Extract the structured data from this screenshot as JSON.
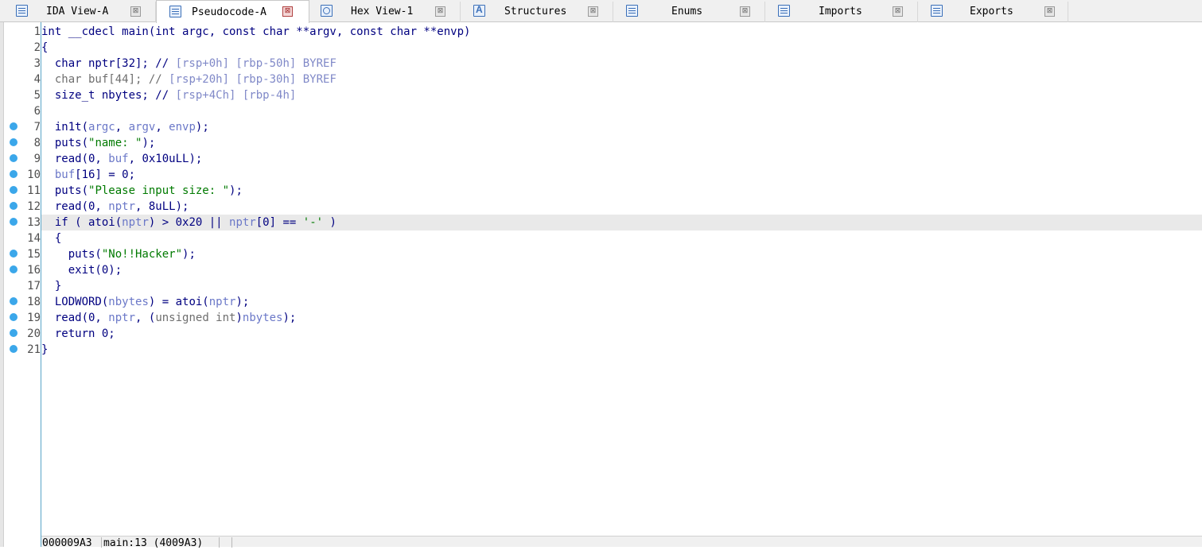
{
  "tabs": [
    {
      "label": "IDA View-A",
      "icon": "ida-view-icon",
      "active": false
    },
    {
      "label": "Pseudocode-A",
      "icon": "pseudocode-icon",
      "active": true
    },
    {
      "label": "Hex View-1",
      "icon": "hex-view-icon",
      "active": false
    },
    {
      "label": "Structures",
      "icon": "structures-icon",
      "active": false
    },
    {
      "label": "Enums",
      "icon": "enums-icon",
      "active": false
    },
    {
      "label": "Imports",
      "icon": "imports-icon",
      "active": false
    },
    {
      "label": "Exports",
      "icon": "exports-icon",
      "active": false
    }
  ],
  "close_glyph": "⊠",
  "editor": {
    "current_line": 13,
    "lines": [
      {
        "num": "1",
        "bp": false,
        "tokens": [
          {
            "t": "int __cdecl main(int argc, const char **argv, const char **envp)",
            "c": "text"
          }
        ]
      },
      {
        "num": "2",
        "bp": false,
        "tokens": [
          {
            "t": "{",
            "c": "text"
          }
        ]
      },
      {
        "num": "3",
        "bp": false,
        "tokens": [
          {
            "t": "  char nptr[32]; // ",
            "c": "text"
          },
          {
            "t": "[rsp+0h] [rbp-50h] BYREF",
            "c": "cmt"
          }
        ]
      },
      {
        "num": "4",
        "bp": false,
        "tokens": [
          {
            "t": "  char buf[44]; // ",
            "c": "gray"
          },
          {
            "t": "[rsp+20h] [rbp-30h] BYREF",
            "c": "cmt"
          }
        ]
      },
      {
        "num": "5",
        "bp": false,
        "tokens": [
          {
            "t": "  size_t nbytes; // ",
            "c": "text"
          },
          {
            "t": "[rsp+4Ch] [rbp-4h]",
            "c": "cmt"
          }
        ]
      },
      {
        "num": "6",
        "bp": false,
        "tokens": []
      },
      {
        "num": "7",
        "bp": true,
        "tokens": [
          {
            "t": "  in1t(",
            "c": "text"
          },
          {
            "t": "argc",
            "c": "var"
          },
          {
            "t": ", ",
            "c": "text"
          },
          {
            "t": "argv",
            "c": "var"
          },
          {
            "t": ", ",
            "c": "text"
          },
          {
            "t": "envp",
            "c": "var"
          },
          {
            "t": ");",
            "c": "text"
          }
        ]
      },
      {
        "num": "8",
        "bp": true,
        "tokens": [
          {
            "t": "  puts(",
            "c": "text"
          },
          {
            "t": "\"name: \"",
            "c": "str"
          },
          {
            "t": ");",
            "c": "text"
          }
        ]
      },
      {
        "num": "9",
        "bp": true,
        "tokens": [
          {
            "t": "  read(0, ",
            "c": "text"
          },
          {
            "t": "buf",
            "c": "var"
          },
          {
            "t": ", 0x10uLL);",
            "c": "text"
          }
        ]
      },
      {
        "num": "10",
        "bp": true,
        "tokens": [
          {
            "t": "  ",
            "c": "text"
          },
          {
            "t": "buf",
            "c": "var"
          },
          {
            "t": "[16] = 0;",
            "c": "text"
          }
        ]
      },
      {
        "num": "11",
        "bp": true,
        "tokens": [
          {
            "t": "  puts(",
            "c": "text"
          },
          {
            "t": "\"Please input size: \"",
            "c": "str"
          },
          {
            "t": ");",
            "c": "text"
          }
        ]
      },
      {
        "num": "12",
        "bp": true,
        "tokens": [
          {
            "t": "  read(0, ",
            "c": "text"
          },
          {
            "t": "nptr",
            "c": "var"
          },
          {
            "t": ", 8uLL);",
            "c": "text"
          }
        ]
      },
      {
        "num": "13",
        "bp": true,
        "tokens": [
          {
            "t": "  if ( atoi(",
            "c": "text"
          },
          {
            "t": "nptr",
            "c": "var"
          },
          {
            "t": ") > 0x20 || ",
            "c": "text"
          },
          {
            "t": "nptr",
            "c": "var"
          },
          {
            "t": "[0] == ",
            "c": "text"
          },
          {
            "t": "'-'",
            "c": "str"
          },
          {
            "t": " )",
            "c": "text"
          }
        ]
      },
      {
        "num": "14",
        "bp": false,
        "tokens": [
          {
            "t": "  {",
            "c": "text"
          }
        ]
      },
      {
        "num": "15",
        "bp": true,
        "tokens": [
          {
            "t": "    puts(",
            "c": "text"
          },
          {
            "t": "\"No!!Hacker\"",
            "c": "str"
          },
          {
            "t": ");",
            "c": "text"
          }
        ]
      },
      {
        "num": "16",
        "bp": true,
        "tokens": [
          {
            "t": "    exit(0);",
            "c": "text"
          }
        ]
      },
      {
        "num": "17",
        "bp": false,
        "tokens": [
          {
            "t": "  }",
            "c": "text"
          }
        ]
      },
      {
        "num": "18",
        "bp": true,
        "tokens": [
          {
            "t": "  LODWORD(",
            "c": "text"
          },
          {
            "t": "nbytes",
            "c": "var"
          },
          {
            "t": ") = atoi(",
            "c": "text"
          },
          {
            "t": "nptr",
            "c": "var"
          },
          {
            "t": ");",
            "c": "text"
          }
        ]
      },
      {
        "num": "19",
        "bp": true,
        "tokens": [
          {
            "t": "  read(0, ",
            "c": "text"
          },
          {
            "t": "nptr",
            "c": "var"
          },
          {
            "t": ", (",
            "c": "text"
          },
          {
            "t": "unsigned int",
            "c": "gray"
          },
          {
            "t": ")",
            "c": "text"
          },
          {
            "t": "nbytes",
            "c": "var"
          },
          {
            "t": ");",
            "c": "text"
          }
        ]
      },
      {
        "num": "20",
        "bp": true,
        "tokens": [
          {
            "t": "  return 0;",
            "c": "text"
          }
        ]
      },
      {
        "num": "21",
        "bp": true,
        "tokens": [
          {
            "t": "}",
            "c": "text"
          }
        ]
      }
    ]
  },
  "status": {
    "address": "000009A3",
    "location": "main:13 (4009A3)"
  }
}
